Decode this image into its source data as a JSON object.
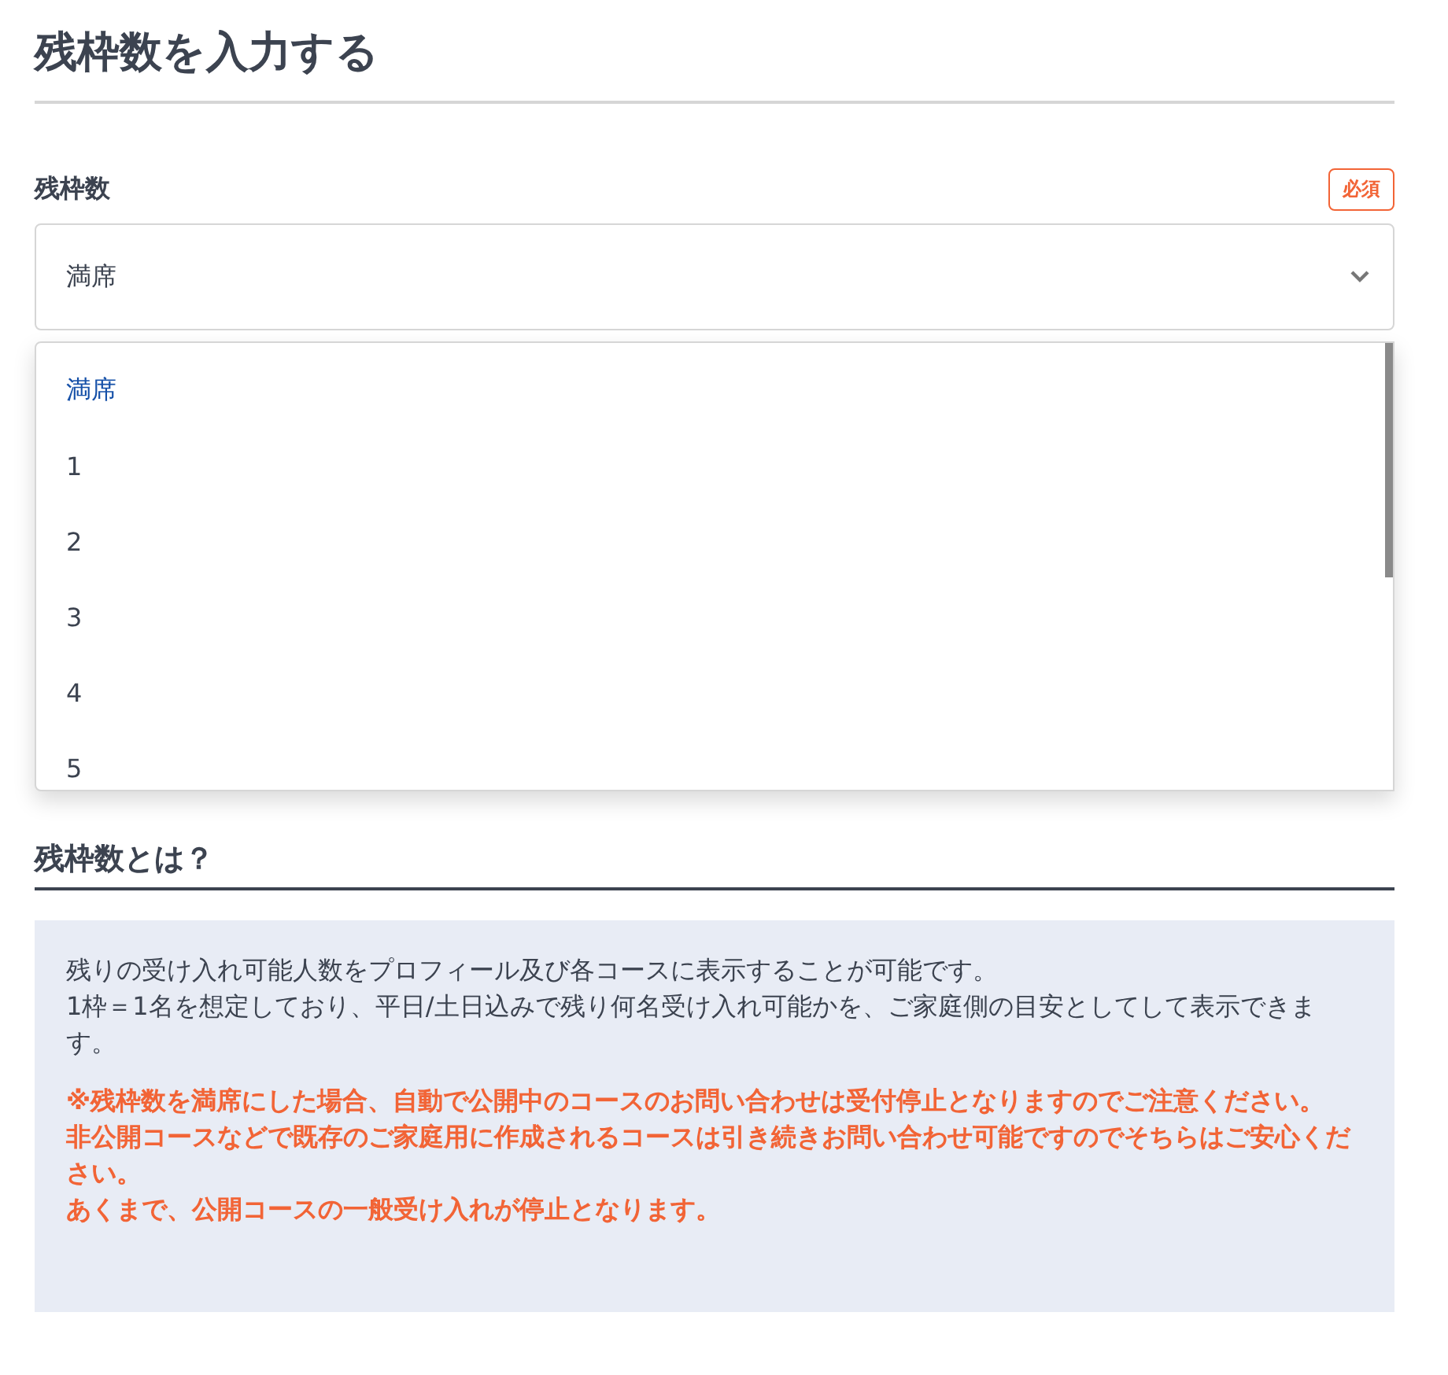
{
  "title": "残枠数を入力する",
  "field": {
    "label": "残枠数",
    "required_badge": "必須",
    "value": "満席"
  },
  "dropdown": {
    "options": [
      {
        "label": "満席",
        "selected": true
      },
      {
        "label": "1",
        "selected": false
      },
      {
        "label": "2",
        "selected": false
      },
      {
        "label": "3",
        "selected": false
      },
      {
        "label": "4",
        "selected": false
      },
      {
        "label": "5",
        "selected": false
      }
    ]
  },
  "info": {
    "heading": "残枠数とは？",
    "description": [
      "残りの受け入れ可能人数をプロフィール及び各コースに表示することが可能です。",
      "1枠＝1名を想定しており、平日/土日込みで残り何名受け入れ可能かを、ご家庭側の目安としてして表示できます。"
    ],
    "notes": [
      "※残枠数を満席にした場合、自動で公開中のコースのお問い合わせは受付停止となりますのでご注意ください。",
      "非公開コースなどで既存のご家庭用に作成されるコースは引き続きお問い合わせ可能ですのでそちらはご安心ください。",
      "あくまで、公開コースの一般受け入れが停止となります。"
    ]
  }
}
